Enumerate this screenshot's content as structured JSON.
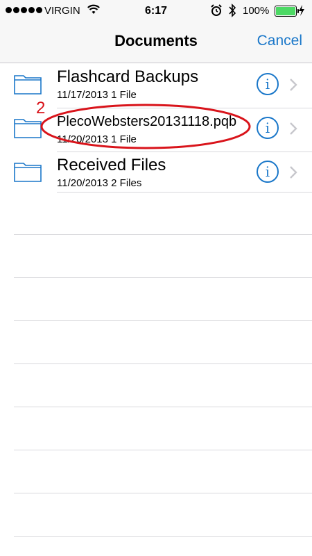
{
  "status": {
    "carrier": "VIRGIN",
    "time": "6:17",
    "battery": "100%",
    "battery_level": 1.0
  },
  "nav": {
    "title": "Documents",
    "cancel": "Cancel"
  },
  "files": [
    {
      "name": "Flashcard Backups",
      "date": "11/17/2013",
      "count": "1 File"
    },
    {
      "name": "PlecoWebsters20131118.pqb",
      "date": "11/20/2013",
      "count": "1 File"
    },
    {
      "name": "Received Files",
      "date": "11/20/2013",
      "count": "2 Files"
    }
  ],
  "annotation": {
    "number": "2",
    "color": "#d9141b"
  },
  "colors": {
    "accent": "#1a77c9",
    "chevron": "#c7c7cc"
  },
  "icons": {
    "folder": "folder-icon",
    "info": "info-icon",
    "chevron": "chevron-right-icon"
  }
}
